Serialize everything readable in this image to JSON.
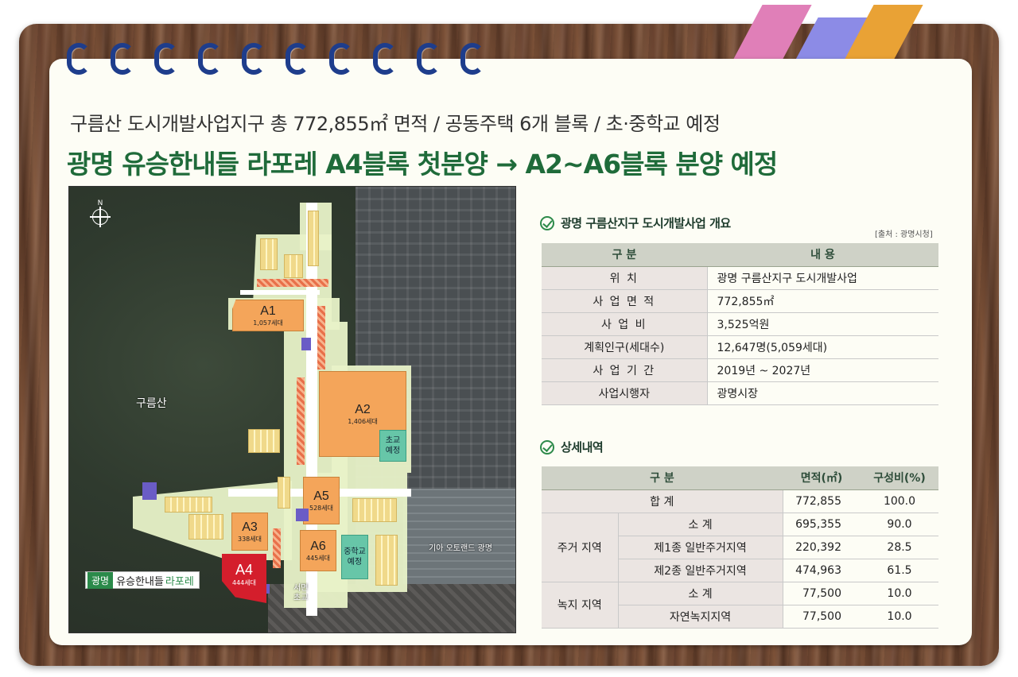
{
  "header": {
    "subtitle": "구름산 도시개발사업지구 총 772,855㎡ 면적 / 공동주택 6개 블록 / 초·중학교 예정",
    "headline": "광명 유승한내들 라포레 A4블록 첫분양 → A2~A6블록 분양 예정"
  },
  "map": {
    "north": "N",
    "mountain": "구름산",
    "blocks": {
      "a1": {
        "name": "A1",
        "count": "1,057세대"
      },
      "a2": {
        "name": "A2",
        "count": "1,406세대"
      },
      "a3": {
        "name": "A3",
        "count": "338세대"
      },
      "a4": {
        "name": "A4",
        "count": "444세대"
      },
      "a5": {
        "name": "A5",
        "count": "528세대"
      },
      "a6": {
        "name": "A6",
        "count": "445세대"
      }
    },
    "elementary_school": {
      "line1": "초교",
      "line2": "예정"
    },
    "middle_school": {
      "line1": "중학교",
      "line2": "예정"
    },
    "seomyeon_school": {
      "line1": "서면",
      "line2": "초교"
    },
    "kia": "기아 오토랜드 광명",
    "callout": {
      "prefix": "광명",
      "middle": "유승한내들",
      "suffix": "라포레"
    }
  },
  "overview": {
    "title": "광명 구름산지구 도시개발사업 개요",
    "source": "[출처 : 광명시청]",
    "headers": [
      "구 분",
      "내 용"
    ],
    "rows": [
      {
        "key": "위 치",
        "value": "광명 구름산지구 도시개발사업"
      },
      {
        "key": "사 업 면 적",
        "value": "772,855㎡"
      },
      {
        "key": "사 업 비",
        "value": "3,525억원"
      },
      {
        "key": "계획인구(세대수)",
        "value": "12,647명(5,059세대)"
      },
      {
        "key": "사 업 기 간",
        "value": "2019년 ~ 2027년"
      },
      {
        "key": "사업시행자",
        "value": "광명시장"
      }
    ]
  },
  "detail": {
    "title": "상세내역",
    "headers": [
      "구 분",
      "면적(㎡)",
      "구성비(%)"
    ],
    "total": {
      "label": "합 계",
      "area": "772,855",
      "ratio": "100.0"
    },
    "residential": {
      "group": "주거 지역",
      "rows": [
        {
          "label": "소 계",
          "area": "695,355",
          "ratio": "90.0"
        },
        {
          "label": "제1종 일반주거지역",
          "area": "220,392",
          "ratio": "28.5"
        },
        {
          "label": "제2종 일반주거지역",
          "area": "474,963",
          "ratio": "61.5"
        }
      ]
    },
    "green": {
      "group": "녹지 지역",
      "rows": [
        {
          "label": "소 계",
          "area": "77,500",
          "ratio": "10.0"
        },
        {
          "label": "자연녹지지역",
          "area": "77,500",
          "ratio": "10.0"
        }
      ]
    }
  }
}
